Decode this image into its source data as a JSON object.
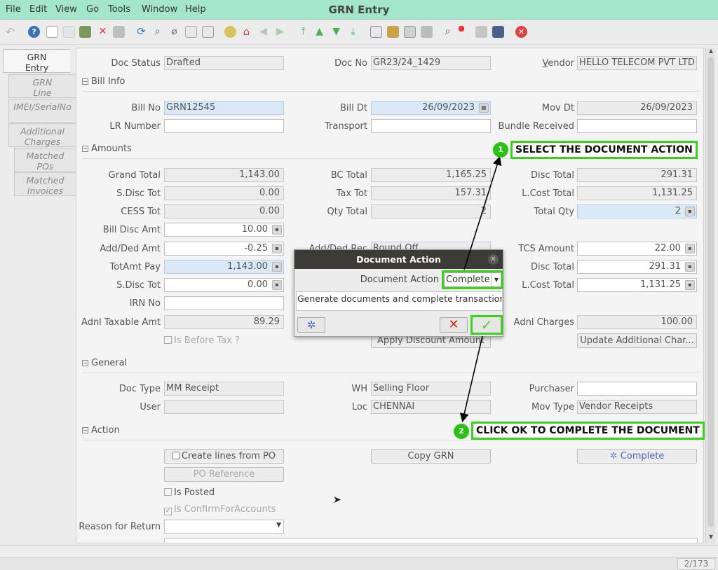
{
  "window": {
    "title": "GRN Entry"
  },
  "menu": [
    "File",
    "Edit",
    "View",
    "Go",
    "Tools",
    "Window",
    "Help"
  ],
  "toolbar_icons": [
    "undo-icon",
    "help-icon",
    "new-icon",
    "copy-icon",
    "save-icon",
    "delete-icon",
    "grid-icon",
    "refresh-icon",
    "find-icon",
    "attach-icon",
    "chat-icon",
    "form-icon",
    "history-icon",
    "home-icon",
    "back-icon",
    "forward-icon",
    "first-icon",
    "up-icon",
    "down-icon",
    "last-icon",
    "report-icon",
    "archive-icon",
    "print-icon",
    "zoom-icon",
    "workflow-icon",
    "request-icon",
    "product-icon",
    "close-icon"
  ],
  "side_tabs": [
    {
      "label": "GRN\nEntry",
      "active": true
    },
    {
      "label": "GRN\nLine"
    },
    {
      "label": "IMEI/SerialNo"
    },
    {
      "label": "Additional\nCharges"
    },
    {
      "label": "Matched\nPOs"
    },
    {
      "label": "Matched\nInvoices"
    }
  ],
  "header": {
    "doc_status_label": "Doc Status",
    "doc_status": "Drafted",
    "doc_no_label": "Doc No",
    "doc_no": "GR23/24_1429",
    "vendor_label": "Vendor",
    "vendor": "HELLO TELECOM PVT LTD"
  },
  "bill_info": {
    "title": "Bill Info",
    "bill_no_label": "Bill No",
    "bill_no": "GRN12545",
    "bill_dt_label": "Bill Dt",
    "bill_dt": "26/09/2023",
    "mov_dt_label": "Mov Dt",
    "mov_dt": "26/09/2023",
    "lr_number_label": "LR Number",
    "lr_number": "",
    "transport_label": "Transport",
    "transport": "",
    "bundle_label": "Bundle Received",
    "bundle": ""
  },
  "amounts": {
    "title": "Amounts",
    "grand_total_label": "Grand Total",
    "grand_total": "1,143.00",
    "bc_total_label": "BC Total",
    "bc_total": "1,165.25",
    "disc_total_label": "Disc Total",
    "disc_total": "291.31",
    "sdisc_tot_label": "S.Disc Tot",
    "sdisc_tot": "0.00",
    "tax_tot_label": "Tax Tot",
    "tax_tot": "157.31",
    "lcost_total_label": "L.Cost Total",
    "lcost_total": "1,131.25",
    "cess_tot_label": "CESS Tot",
    "cess_tot": "0.00",
    "qty_total_label": "Qty Total",
    "qty_total": "2",
    "total_qty_label": "Total Qty",
    "total_qty": "2",
    "bill_disc_amt_label": "Bill Disc Amt",
    "bill_disc_amt": "10.00",
    "add_ded_amt_label": "Add/Ded Amt",
    "add_ded_amt": "-0.25",
    "add_ded_rec_label": "Add/Ded Rec",
    "add_ded_rec": "Round Off",
    "tcs_amount_label": "TCS Amount",
    "tcs_amount": "22.00",
    "totamt_pay_label": "TotAmt Pay",
    "totamt_pay": "1,143.00",
    "disc_total2_label": "Disc Total",
    "disc_total2": "291.31",
    "sdisc_tot2_label": "S.Disc Tot",
    "sdisc_tot2": "0.00",
    "lcost_total2_label": "L.Cost Total",
    "lcost_total2": "1,131.25",
    "irn_no_label": "IRN No",
    "irn_no": "",
    "adnl_taxable_label": "Adnl Taxable Amt",
    "adnl_taxable": "89.29",
    "adnl_charges_label": "Adnl Charges",
    "adnl_charges": "100.00",
    "is_before_tax_label": "Is Before Tax ?",
    "apply_discount_label": "Apply Discount Amount",
    "update_additional_label": "Update Additional Char..."
  },
  "general": {
    "title": "General",
    "doc_type_label": "Doc Type",
    "doc_type": "MM Receipt",
    "wh_label": "WH",
    "wh": "Selling Floor",
    "purchaser_label": "Purchaser",
    "purchaser": "",
    "user_label": "User",
    "user": "",
    "loc_label": "Loc",
    "loc": "CHENNAI",
    "mov_type_label": "Mov Type",
    "mov_type": "Vendor Receipts"
  },
  "action": {
    "title": "Action",
    "create_lines_label": "Create lines from PO",
    "copy_grn_label": "Copy GRN",
    "complete_label": "Complete",
    "po_reference_label": "PO Reference",
    "is_posted_label": "Is Posted",
    "is_confirm_label": "Is ConfirmForAccounts",
    "reason_return_label": "Reason for Return",
    "reason_return": ""
  },
  "dialog": {
    "title": "Document Action",
    "action_label": "Document Action",
    "action_value": "Complete",
    "description": "Generate documents and complete transaction"
  },
  "callouts": [
    {
      "number": "1",
      "text": "SELECT THE DOCUMENT ACTION"
    },
    {
      "number": "2",
      "text": "CLICK OK TO COMPLETE THE DOCUMENT"
    }
  ],
  "pager": "2/173",
  "colors": {
    "menubar": "#a3e6cd",
    "callout": "#39d11e",
    "required_field": "#dbe8f7",
    "cancel": "#d8261f",
    "ok": "#6fbf2a"
  }
}
